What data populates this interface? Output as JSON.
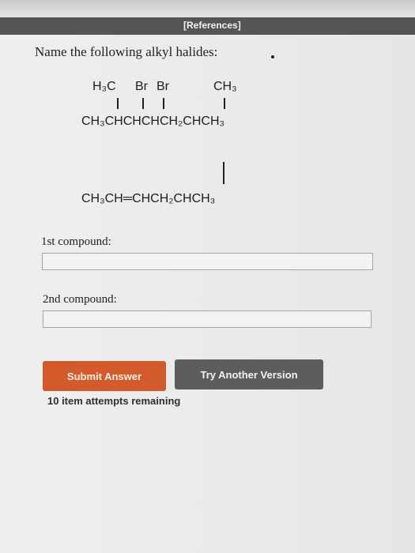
{
  "header": {
    "references_label": "[References]"
  },
  "question": {
    "prompt": "Name the following alkyl halides:",
    "compound1": {
      "substituents": {
        "h3c": "H₃C",
        "br1": "Br",
        "br2": "Br",
        "ch3": "CH₃"
      },
      "main_chain": "CH₃CHCHCHCH₂CHCH₃"
    },
    "compound2": {
      "main_chain": "CH₃CH═CHCH₂CHCH₃"
    }
  },
  "answers": {
    "first_label": "1st compound:",
    "first_value": "",
    "second_label": "2nd compound:",
    "second_value": ""
  },
  "actions": {
    "submit_label": "Submit Answer",
    "try_another_label": "Try Another Version",
    "attempts_text": "10 item attempts remaining"
  },
  "colors": {
    "submit_button": "#d35a2a",
    "try_button": "#5d5d5d",
    "references_bar": "#555555"
  }
}
